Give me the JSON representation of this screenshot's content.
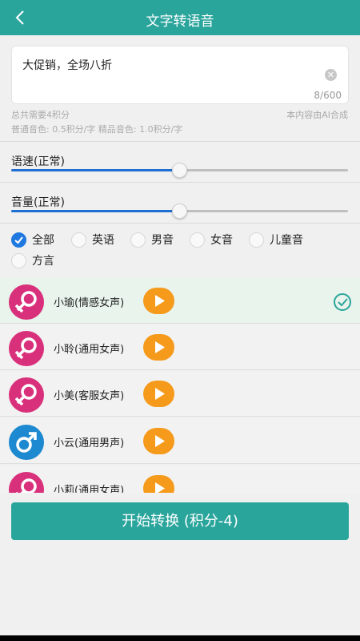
{
  "header": {
    "title": "文字转语音"
  },
  "text_input": {
    "value": "大促销，全场八折",
    "char_count": "8/600"
  },
  "info": {
    "points_needed": "总共需要4积分",
    "ai_note": "本内容由AI合成",
    "pricing": "普通音色: 0.5积分/字 精品音色: 1.0积分/字"
  },
  "speed": {
    "label": "语速(正常)",
    "level": 0.5
  },
  "volume": {
    "label": "音量(正常)",
    "level": 0.5
  },
  "filters": [
    {
      "label": "全部",
      "checked": true
    },
    {
      "label": "英语",
      "checked": false
    },
    {
      "label": "男音",
      "checked": false
    },
    {
      "label": "女音",
      "checked": false
    },
    {
      "label": "儿童音",
      "checked": false
    },
    {
      "label": "方言",
      "checked": false
    }
  ],
  "voices": [
    {
      "name": "小瑜(情感女声)",
      "gender": "female",
      "selected": true
    },
    {
      "name": "小聆(通用女声)",
      "gender": "female",
      "selected": false
    },
    {
      "name": "小美(客服女声)",
      "gender": "female",
      "selected": false
    },
    {
      "name": "小云(通用男声)",
      "gender": "male",
      "selected": false
    },
    {
      "name": "小莉(通用女声)",
      "gender": "female",
      "selected": false
    }
  ],
  "convert_button": {
    "label": "开始转换 (积分-4)"
  },
  "colors": {
    "primary": "#2aa59c",
    "accent": "#1f78e0",
    "play": "#f59a1b",
    "female": "#d9307b",
    "male": "#1d89d0"
  }
}
